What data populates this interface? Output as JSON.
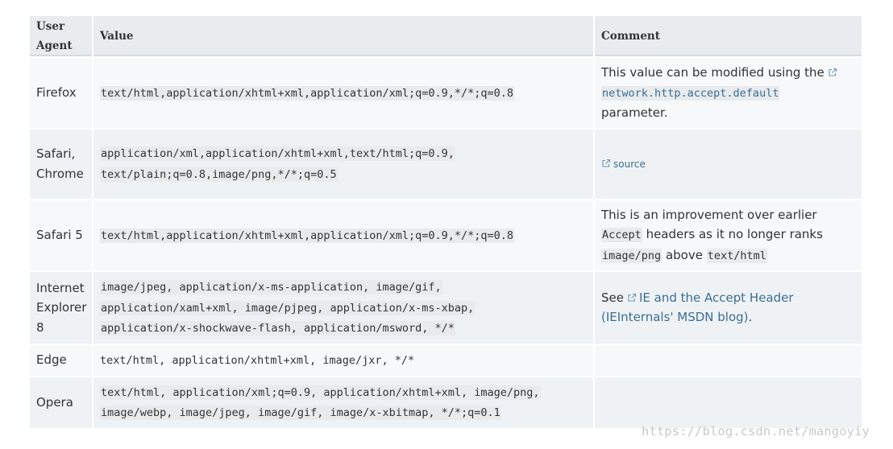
{
  "table": {
    "headers": {
      "user_agent": "User Agent",
      "value": "Value",
      "comment": "Comment"
    },
    "rows": [
      {
        "user_agent": "Firefox",
        "value_lines": [
          "text/html,application/xhtml+xml,application/xml;q=0.9,*/*;q=0.8"
        ],
        "comment": {
          "text_before": "This value can be modified using the",
          "link_code": "network.http.accept.default",
          "text_after": "parameter."
        }
      },
      {
        "user_agent": "Safari, Chrome",
        "value_lines": [
          "application/xml,application/xhtml+xml,text/html;q=0.9,",
          "text/plain;q=0.8,image/png,*/*;q=0.5"
        ],
        "comment": {
          "link": "source"
        }
      },
      {
        "user_agent": "Safari 5",
        "value_lines": [
          "text/html,application/xhtml+xml,application/xml;q=0.9,*/*;q=0.8"
        ],
        "comment": {
          "text_before": "This is an improvement over earlier",
          "code1": "Accept",
          "text_middle": "headers as it no longer ranks",
          "code2": "image/png",
          "text_middle2": "above",
          "code3": "text/html"
        }
      },
      {
        "user_agent": "Internet Explorer 8",
        "value_lines": [
          "image/jpeg, application/x-ms-application, image/gif,",
          "application/xaml+xml, image/pjpeg, application/x-ms-xbap,",
          "application/x-shockwave-flash, application/msword, */*"
        ],
        "comment": {
          "text_before": "See",
          "link": "IE and the Accept Header",
          "link2": "(IEInternals' MSDN blog)",
          "text_after": "."
        }
      },
      {
        "user_agent": "Edge",
        "value_lines": [
          "text/html, application/xhtml+xml, image/jxr, */*"
        ],
        "comment": {}
      },
      {
        "user_agent": "Opera",
        "value_lines": [
          "text/html, application/xml;q=0.9, application/xhtml+xml, image/png,",
          "image/webp, image/jpeg, image/gif, image/x-xbitmap, */*;q=0.1"
        ],
        "comment": {}
      }
    ]
  },
  "watermark": "https://blog.csdn.net/mangoyiy",
  "icons": {
    "external_link": "external-link-icon"
  },
  "colors": {
    "link": "#3a6e96",
    "header_bg": "#e9ecee",
    "row_bg_odd": "#f6f8f9",
    "row_bg_even": "#eff2f4",
    "code_bg": "#e8eaec",
    "text": "#333333",
    "watermark": "#c9c9c9"
  }
}
